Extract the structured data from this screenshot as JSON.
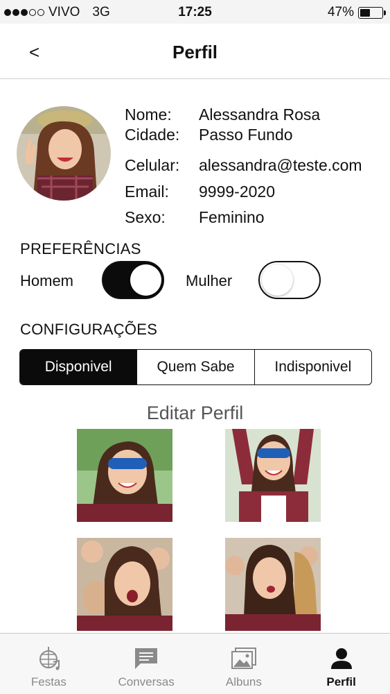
{
  "status_bar": {
    "carrier": "VIVO",
    "network": "3G",
    "time": "17:25",
    "battery_text": "47%",
    "battery_level": 0.47,
    "signal_bars": 3
  },
  "nav": {
    "back_label": "<",
    "title": "Perfil"
  },
  "profile": {
    "fields": [
      {
        "label": "Nome:",
        "value": "Alessandra Rosa"
      },
      {
        "label": "Cidade:",
        "value": "Passo Fundo"
      },
      {
        "label": "Celular:",
        "value": "alessandra@teste.com"
      },
      {
        "label": "Email:",
        "value": "9999-2020"
      },
      {
        "label": "Sexo:",
        "value": "Feminino"
      }
    ]
  },
  "preferences": {
    "title": "PREFERÊNCIAS",
    "options": [
      {
        "label": "Homem",
        "enabled": true
      },
      {
        "label": "Mulher",
        "enabled": false
      }
    ]
  },
  "settings": {
    "title": "CONFIGURAÇÕES",
    "segments": [
      "Disponivel",
      "Quem Sabe",
      "Indisponivel"
    ],
    "selected": "Disponivel"
  },
  "edit_profile_label": "Editar Perfil",
  "tabs": [
    {
      "label": "Festas",
      "icon": "disco-ball-icon",
      "active": false
    },
    {
      "label": "Conversas",
      "icon": "chat-icon",
      "active": false
    },
    {
      "label": "Albuns",
      "icon": "photo-album-icon",
      "active": false
    },
    {
      "label": "Perfil",
      "icon": "person-icon",
      "active": true
    }
  ],
  "colors": {
    "active": "#0b0b0b",
    "inactive_tab": "#8a8a8a",
    "status_bar_bg": "#f4f4f4"
  }
}
